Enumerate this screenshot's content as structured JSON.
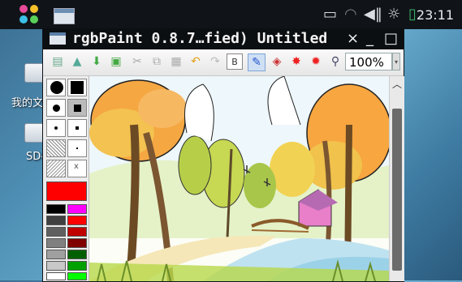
{
  "statusbar": {
    "clock": "23:11",
    "icons": [
      "tray-icon",
      "wifi-icon",
      "volume-icon",
      "brightness-icon",
      "battery-icon"
    ]
  },
  "desktop": {
    "items": [
      {
        "label": "我的文",
        "icon": "folder-icon"
      },
      {
        "label": "SD-",
        "icon": "folder-icon"
      }
    ]
  },
  "window": {
    "title": "rgbPaint 0.8.7…fied) Untitled",
    "close": "×",
    "minimize": "_",
    "maximize": "□"
  },
  "toolbar": {
    "zoom": "100%",
    "tools": [
      "new-file-icon",
      "open-file-icon",
      "save-icon",
      "save-as-icon",
      "cut-icon",
      "copy-icon",
      "paste-icon",
      "undo-icon",
      "redo-icon",
      "text-tool-icon",
      "pencil-icon",
      "fill-icon",
      "spray-icon",
      "star-brush-icon",
      "magnify-icon"
    ]
  },
  "palette": {
    "active_color": "#ff0000",
    "colors_left": [
      "#000000",
      "#404040",
      "#606060",
      "#808080",
      "#a0a0a0",
      "#c8c8c8",
      "#ffffff",
      "#8ab8e8"
    ],
    "colors_right": [
      "#ff00ff",
      "#ff0000",
      "#c00000",
      "#800000",
      "#006000",
      "#00a000",
      "#00ff00",
      "#ffff00"
    ]
  }
}
